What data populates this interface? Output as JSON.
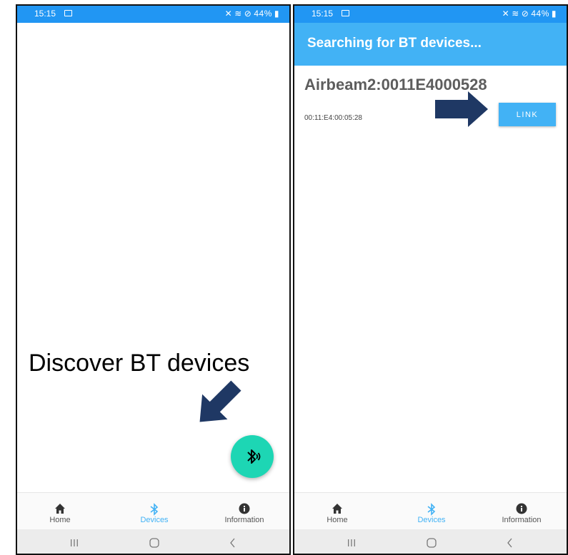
{
  "left_screen": {
    "status": {
      "time": "15:15",
      "battery": "44%"
    },
    "bottom_nav": {
      "items": [
        {
          "label": "Home",
          "icon": "home-icon"
        },
        {
          "label": "Devices",
          "icon": "bluetooth-icon",
          "active": true
        },
        {
          "label": "Information",
          "icon": "info-icon"
        }
      ]
    },
    "fab": {
      "icon": "bluetooth-searching-icon"
    }
  },
  "right_screen": {
    "status": {
      "time": "15:15",
      "battery": "44%"
    },
    "title": "Searching for BT devices...",
    "device": {
      "name": "Airbeam2:0011E4000528",
      "address": "00:11:E4:00:05:28",
      "button_label": "LINK"
    },
    "bottom_nav": {
      "items": [
        {
          "label": "Home",
          "icon": "home-icon"
        },
        {
          "label": "Devices",
          "icon": "bluetooth-icon",
          "active": true
        },
        {
          "label": "Information",
          "icon": "info-icon"
        }
      ]
    }
  },
  "annotation": {
    "text": "Discover BT devices"
  },
  "colors": {
    "primary": "#2196f3",
    "app_bar": "#42b2f5",
    "fab": "#1dd6b4",
    "arrow": "#1f3864"
  }
}
